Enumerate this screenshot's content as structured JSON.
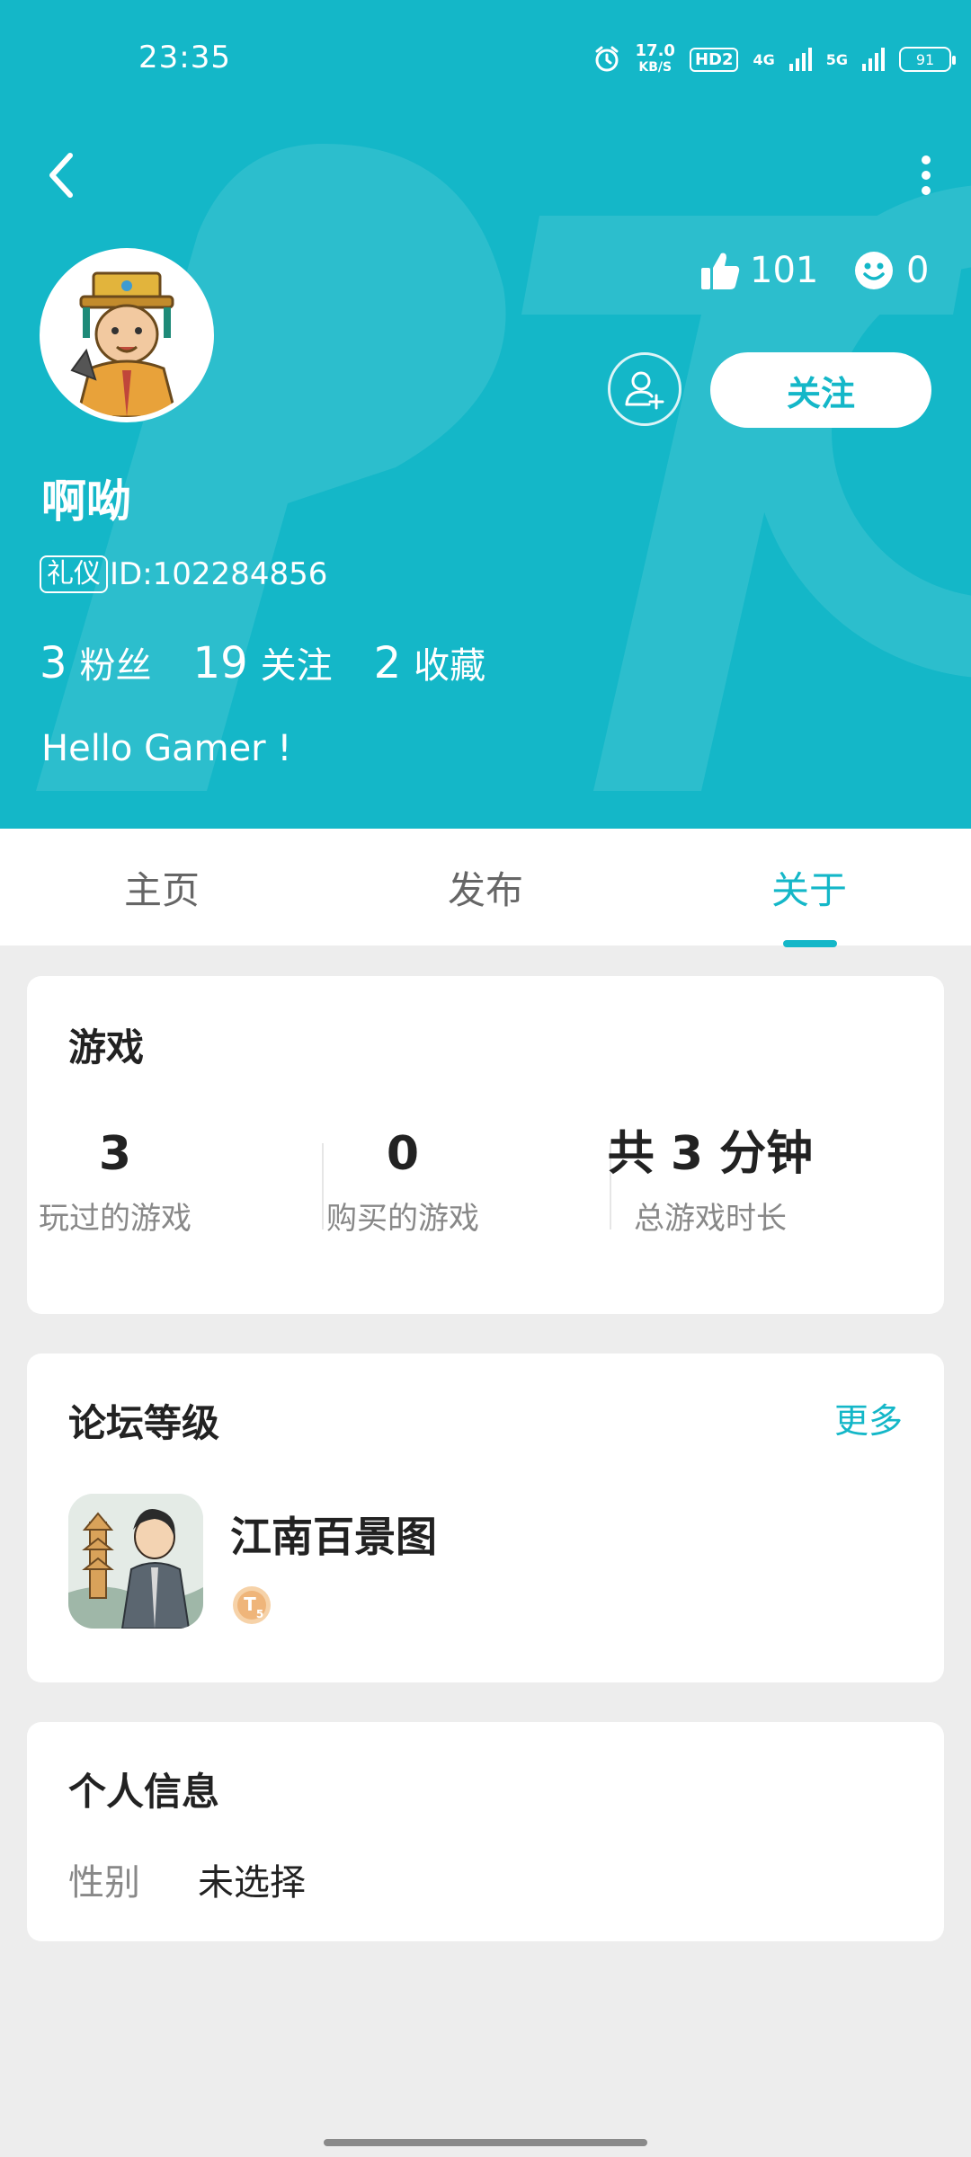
{
  "status_bar": {
    "time": "23:35",
    "speed_value": "17.0",
    "speed_unit": "KB/S",
    "hd_label": "HD2",
    "net1": "4G",
    "net2": "5G",
    "battery": "91",
    "icons": [
      "alarm-icon",
      "signal-icon",
      "battery-icon"
    ]
  },
  "header": {
    "bg_color": "#14b7c8",
    "likes_count": "101",
    "smiles_count": "0",
    "follow_label": "关注",
    "user_name": "啊呦",
    "role_badge": "礼仪",
    "user_id": "ID:102284856",
    "stats": [
      {
        "value": "3",
        "label": "粉丝"
      },
      {
        "value": "19",
        "label": "关注"
      },
      {
        "value": "2",
        "label": "收藏"
      }
    ],
    "bio": "Hello Gamer !"
  },
  "tabs": [
    {
      "label": "主页",
      "active": false
    },
    {
      "label": "发布",
      "active": false
    },
    {
      "label": "关于",
      "active": true
    }
  ],
  "games_card": {
    "title": "游戏",
    "metrics": [
      {
        "value": "3",
        "desc": "玩过的游戏"
      },
      {
        "value": "0",
        "desc": "购买的游戏"
      },
      {
        "value": "共 3 分钟",
        "desc": "总游戏时长"
      }
    ]
  },
  "forum_card": {
    "title": "论坛等级",
    "more_label": "更多",
    "game_name": "江南百景图",
    "level_badge_text": "T",
    "level_badge_sub": "5"
  },
  "personal_card": {
    "title": "个人信息",
    "gender_label": "性别",
    "gender_value": "未选择"
  }
}
